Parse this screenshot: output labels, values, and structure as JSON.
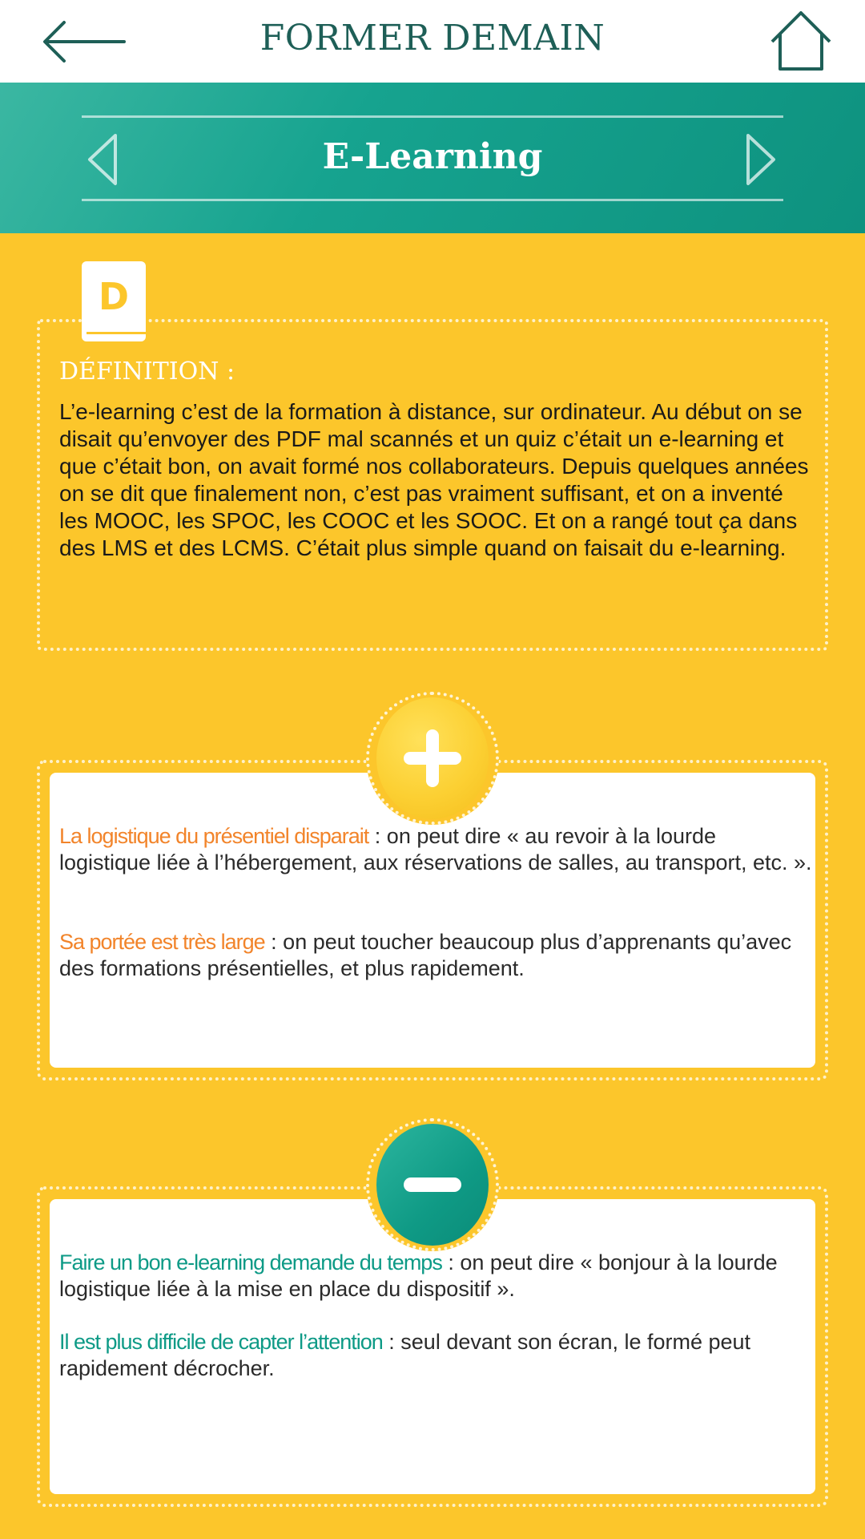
{
  "header": {
    "title": "FORMER DEMAIN",
    "back_icon": "arrow-left-icon",
    "home_icon": "home-icon",
    "accent_color": "#1e5f57"
  },
  "banner": {
    "title": "E-Learning",
    "prev_icon": "chevron-left-icon",
    "next_icon": "chevron-right-icon",
    "color": "#16a38f"
  },
  "definition": {
    "icon": "book-d-icon",
    "icon_letter": "D",
    "title": "DÉFINITION :",
    "text": "L’e-learning c’est de la formation à distance, sur ordinateur. Au début on se disait qu’envoyer des PDF mal scannés et un quiz c’était un e-learning et que c’était bon, on avait formé nos collaborateurs. Depuis quelques années on se dit que finalement non, c’est pas vraiment suffisant, et on a inventé les MOOC, les SPOC, les COOC et les SOOC. Et on a rangé tout ça dans des LMS et des LCMS. C’était plus simple quand on faisait du e-learning."
  },
  "pros": {
    "icon": "plus-icon",
    "items": [
      {
        "heading": "La logistique du présentiel disparait",
        "separator": " : ",
        "text": "on peut dire « au revoir à la lourde logistique liée à l’hébergement, aux réservations de salles, au transport, etc. »."
      },
      {
        "heading": "Sa portée est très large",
        "separator": " : ",
        "text": "on peut toucher beaucoup plus d’apprenants qu’avec des formations présentielles, et plus rapidement."
      }
    ],
    "color": "#f2842a"
  },
  "cons": {
    "icon": "minus-icon",
    "items": [
      {
        "heading": "Faire un bon e-learning demande du temps",
        "separator": " : ",
        "text": "on peut dire « bonjour à la lourde logistique liée à la mise en place du dispositif »."
      },
      {
        "heading": "Il est plus difficile de capter l’attention",
        "separator": " : ",
        "text": "seul devant son écran, le formé peut rapidement décrocher."
      }
    ],
    "color": "#0d9a86"
  },
  "background_color": "#fcc62b"
}
